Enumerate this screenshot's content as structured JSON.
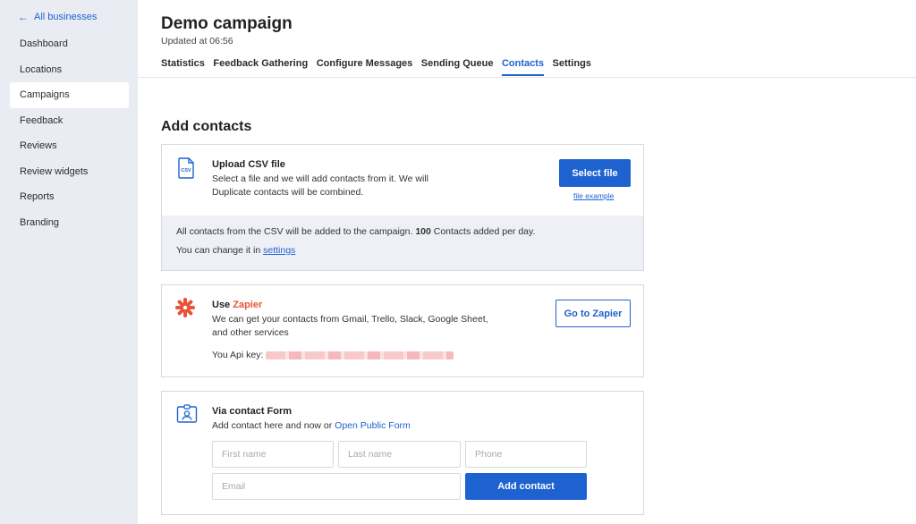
{
  "sidebar": {
    "back_label": "All businesses",
    "items": [
      {
        "label": "Dashboard"
      },
      {
        "label": "Locations"
      },
      {
        "label": "Campaigns",
        "active": true
      },
      {
        "label": "Feedback"
      },
      {
        "label": "Reviews"
      },
      {
        "label": "Review widgets"
      },
      {
        "label": "Reports"
      },
      {
        "label": "Branding"
      }
    ]
  },
  "header": {
    "title": "Demo campaign",
    "updated": "Updated at 06:56",
    "tabs": [
      {
        "label": "Statistics"
      },
      {
        "label": "Feedback Gathering"
      },
      {
        "label": "Configure Messages"
      },
      {
        "label": "Sending Queue"
      },
      {
        "label": "Contacts",
        "active": true
      },
      {
        "label": "Settings"
      }
    ]
  },
  "main": {
    "section_title": "Add contacts",
    "csv": {
      "heading": "Upload CSV file",
      "desc_line1": "Select a file and we will add contacts from it. We will",
      "desc_line2": "Duplicate contacts will be combined.",
      "button": "Select file",
      "example_link": "file example",
      "icon_label": "CSV",
      "footer_prefix": "All contacts from the CSV will be added to the campaign. ",
      "footer_count": "100",
      "footer_suffix": " Contacts added per day.",
      "change_prefix": "You can change it in ",
      "change_link": "settings"
    },
    "zapier": {
      "heading_prefix": "Use ",
      "heading_brand": "Zapier",
      "desc_line1": "We can get your contacts from Gmail, Trello, Slack, Google Sheet,",
      "desc_line2": "and other services",
      "api_label": "You Api key:",
      "button": "Go to Zapier"
    },
    "form": {
      "heading": "Via contact Form",
      "desc_prefix": "Add contact here and now or ",
      "desc_link": "Open Public Form",
      "first_name_placeholder": "First name",
      "last_name_placeholder": "Last name",
      "phone_placeholder": "Phone",
      "email_placeholder": "Email",
      "button": "Add contact"
    }
  },
  "colors": {
    "accent": "#1e62d0",
    "zapier": "#e8533a",
    "sidebar_bg": "#e9ecf3"
  }
}
